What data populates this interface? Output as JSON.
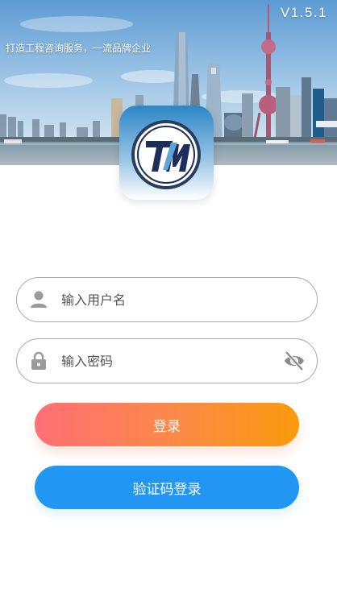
{
  "app": {
    "version": "V1.5.1",
    "slogan": "打造工程咨询服务，一流品牌企业"
  },
  "form": {
    "username_placeholder": "输入用户名",
    "password_placeholder": "输入密码",
    "username_value": "",
    "password_value": ""
  },
  "buttons": {
    "login_label": "登录",
    "code_login_label": "验证码登录"
  },
  "icons": {
    "user": "user-icon",
    "lock": "lock-icon",
    "eye": "eye-off-icon"
  },
  "colors": {
    "login_gradient_start": "#ff6f76",
    "login_gradient_end": "#fb9a0c",
    "code_button": "#2196f3",
    "input_border": "#a9a9a9",
    "logo_navy": "#1c2f5a"
  }
}
